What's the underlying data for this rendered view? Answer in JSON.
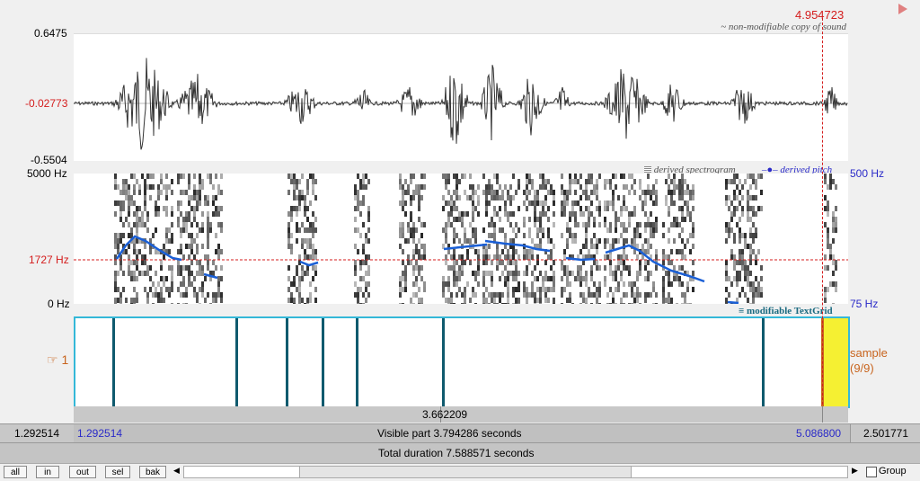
{
  "cursor_time": "4.954723",
  "waveform": {
    "max_label": "0.6475",
    "mid_label": "-0.02773",
    "min_label": "-0.5504",
    "caption": "~ non-modifiable copy of sound"
  },
  "spectrogram": {
    "top_label": "5000 Hz",
    "cursor_label": "1727 Hz",
    "bottom_label": "0 Hz",
    "legend_spectrogram": "derived spectrogram",
    "legend_pitch": "derived pitch",
    "pitch_top": "500 Hz",
    "pitch_bottom": "75 Hz"
  },
  "textgrid": {
    "caption": "modifiable TextGrid",
    "tier_number": "1",
    "tier_name": "sample",
    "tier_count": "(9/9)",
    "interval_duration": "3.662209"
  },
  "time_bar": {
    "left_outside": "1.292514",
    "start": "1.292514",
    "visible_part": "Visible part 3.794286 seconds",
    "end": "5.086800",
    "right_outside": "2.501771",
    "total_duration": "Total duration 7.588571 seconds"
  },
  "buttons": {
    "all": "all",
    "in": "in",
    "out": "out",
    "sel": "sel",
    "bak": "bak"
  },
  "group_label": "Group",
  "colors": {
    "cursor": "#d41c1c",
    "pitch": "#1a5fd6",
    "tier_border": "#34b8d8",
    "boundary": "#0f5a6e",
    "selection": "#f5f032"
  }
}
